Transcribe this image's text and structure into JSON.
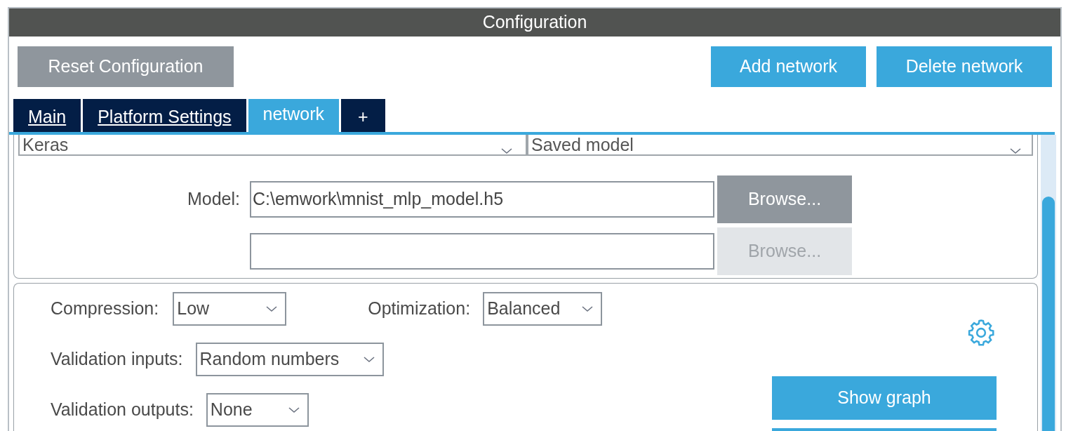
{
  "window": {
    "title": "Configuration"
  },
  "toolbar": {
    "reset_button": "Reset Configuration",
    "buttons": [
      "Add network",
      "Delete network"
    ]
  },
  "tabs": [
    {
      "label": "Main",
      "selected": false,
      "kind": "link"
    },
    {
      "label": "Platform Settings",
      "selected": false,
      "kind": "link"
    },
    {
      "label": "network",
      "selected": true,
      "kind": "tab"
    },
    {
      "label": "+",
      "selected": false,
      "kind": "add"
    }
  ],
  "model_panel": {
    "framework": "Keras",
    "model_type": "Saved model",
    "model_label": "Model:",
    "files": [
      {
        "value": "C:\\emwork\\mnist_mlp_model.h5",
        "browse": "Browse...",
        "disabled": false
      },
      {
        "browse": "Browse...",
        "disabled": true
      }
    ]
  },
  "settings_panel": {
    "compression": {
      "label": "Compression:",
      "value": "Low"
    },
    "optimization": {
      "label": "Optimization:",
      "value": "Balanced"
    },
    "validation_inputs": {
      "label": "Validation inputs:",
      "value": "Random numbers"
    },
    "validation_outputs": {
      "label": "Validation outputs:",
      "value": "None"
    },
    "show_graph": "Show graph"
  }
}
